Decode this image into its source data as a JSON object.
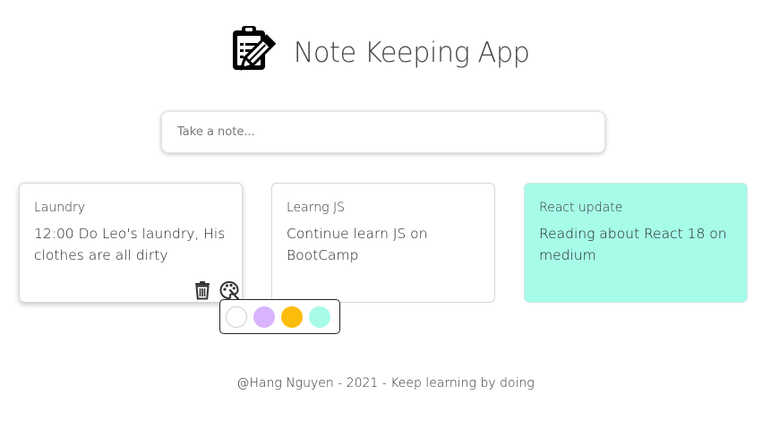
{
  "header": {
    "title": "Note Keeping App",
    "logo_icon": "clipboard-pencil-icon"
  },
  "input": {
    "placeholder": "Take a note..."
  },
  "notes": [
    {
      "title": "Laundry",
      "content": "12:00 Do Leo's laundry, His clothes are all dirty",
      "color": "#ffffff"
    },
    {
      "title": "Learng JS",
      "content": "Continue learn JS on BootCamp",
      "color": "#ffffff"
    },
    {
      "title": "React update",
      "content": "Reading about React 18 on medium",
      "color": "#a7fbe9"
    }
  ],
  "note_actions": {
    "delete_icon": "trash-icon",
    "palette_icon": "palette-icon"
  },
  "palette": {
    "colors": [
      "#ffffff",
      "#d8b4fe",
      "#fbbc0c",
      "#a7fbe9"
    ]
  },
  "footer": {
    "text": "@Hang Nguyen - 2021 - Keep learning by doing"
  }
}
